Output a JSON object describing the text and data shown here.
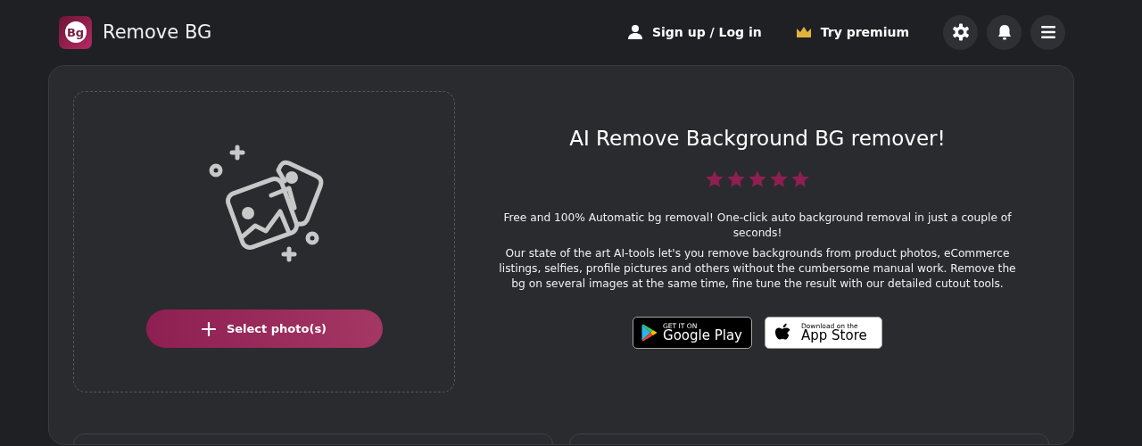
{
  "header": {
    "logo_text": "Bg",
    "brand": "Remove BG",
    "links": [
      {
        "kind": "account",
        "label": "Sign up / Log in"
      },
      {
        "kind": "premium",
        "label": "Try premium"
      }
    ],
    "icon_buttons": [
      {
        "kind": "settings"
      },
      {
        "kind": "notifications"
      },
      {
        "kind": "menu"
      }
    ]
  },
  "uploader": {
    "button": "Select photo(s)"
  },
  "intro": {
    "title": "AI Remove Background BG remover!",
    "stars": 5,
    "paragraphs": [
      "Free and 100% Automatic bg removal! One-click auto background removal in just a couple of seconds!",
      "Our state of the art AI-tools let's you remove backgrounds from product photos, eCommerce listings, selfies, profile pictures and others without the cumbersome manual work. Remove the bg on several images at the same time, fine tune the result with our detailed cutout tools."
    ],
    "stores": [
      {
        "kind": "google",
        "small": "GET IT ON",
        "big": "Google Play"
      },
      {
        "kind": "apple",
        "small": "Download on the",
        "big": "App Store"
      }
    ]
  }
}
